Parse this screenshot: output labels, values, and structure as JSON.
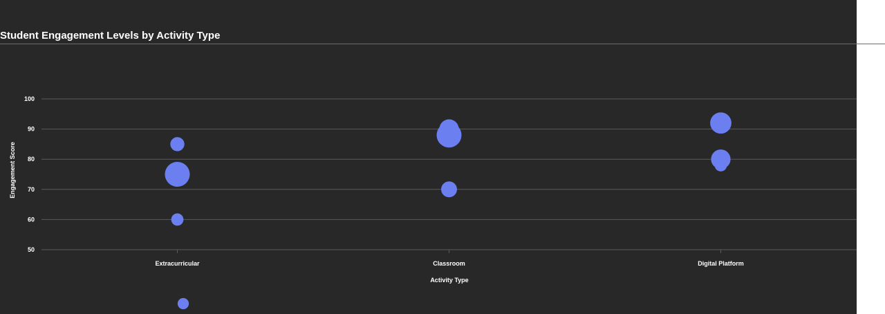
{
  "chart_data": {
    "type": "scatter",
    "title": "Student Engagement Levels by Activity Type",
    "xlabel": "Activity Type",
    "ylabel": "Engagement Score",
    "categories": [
      "Extracurricular",
      "Classroom",
      "Digital Platform"
    ],
    "y_ticks": [
      "50",
      "60",
      "70",
      "80",
      "90",
      "100"
    ],
    "ylim": [
      50,
      100
    ],
    "grid": true,
    "legend": "none",
    "colors": {
      "marker": "#6b7ff0",
      "background": "#282828",
      "grid": "#5a5a5a",
      "text": "#ffffff"
    },
    "points": [
      {
        "category": "Extracurricular",
        "y": 85,
        "size": 2
      },
      {
        "category": "Extracurricular",
        "y": 75,
        "size": 5
      },
      {
        "category": "Extracurricular",
        "y": 60,
        "size": 1.5
      },
      {
        "category": "Classroom",
        "y": 90,
        "size": 3.5
      },
      {
        "category": "Classroom",
        "y": 88,
        "size": 5
      },
      {
        "category": "Classroom",
        "y": 70,
        "size": 2.5
      },
      {
        "category": "Digital Platform",
        "y": 92,
        "size": 4
      },
      {
        "category": "Digital Platform",
        "y": 80,
        "size": 3.5
      },
      {
        "category": "Digital Platform",
        "y": 78,
        "size": 1.5
      }
    ],
    "legend_marker": {
      "size": 1.2
    }
  }
}
